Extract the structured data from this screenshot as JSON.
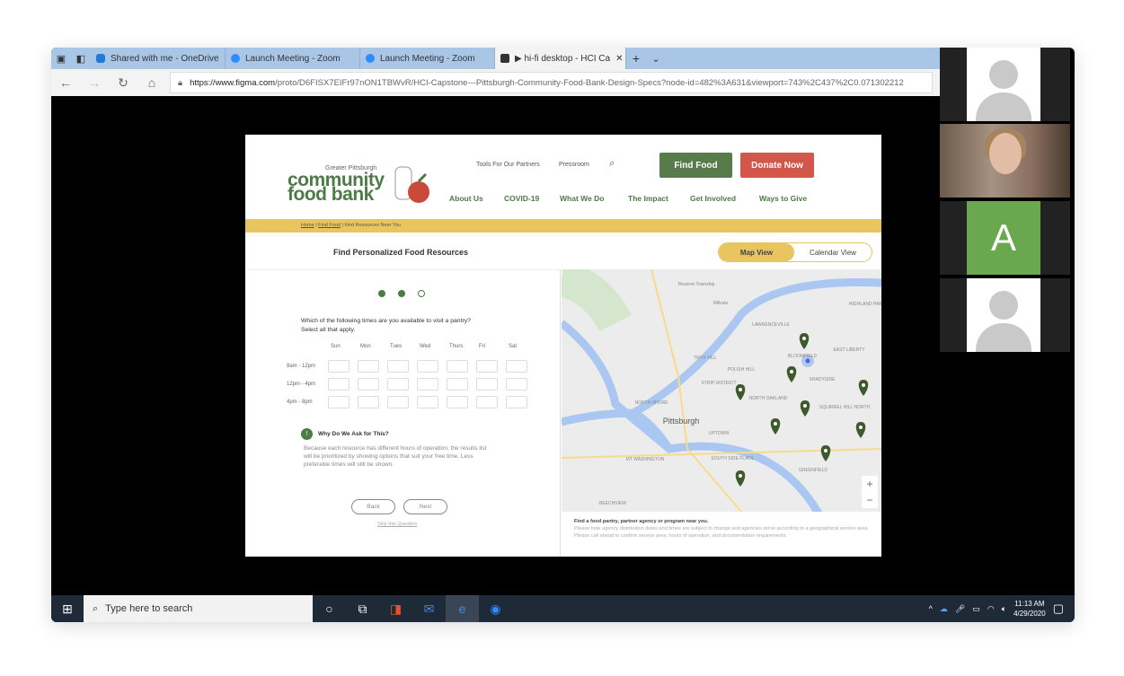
{
  "browser": {
    "tabs": [
      {
        "label": "Shared with me - OneDrive",
        "icon": "cloud-icon"
      },
      {
        "label": "Launch Meeting - Zoom",
        "icon": "zoom-icon"
      },
      {
        "label": "Launch Meeting - Zoom",
        "icon": "zoom-icon"
      },
      {
        "label": "▶ hi-fi desktop - HCI Ca",
        "icon": "figma-icon",
        "active": true
      }
    ],
    "close": "✕",
    "new_tab": "+",
    "tab_menu": "⌄",
    "url_domain": "https://www.figma.com",
    "url_path": "/proto/D6FISX7EIFr97nON1TBWvR/HCI-Capstone---Pittsburgh-Community-Food-Bank-Design-Specs?node-id=482%3A631&viewport=743%2C437%2C0.071302212"
  },
  "participants": [
    {
      "type": "placeholder"
    },
    {
      "type": "video"
    },
    {
      "type": "avatar",
      "initial": "A",
      "color": "#6aa84f"
    },
    {
      "type": "placeholder"
    }
  ],
  "site": {
    "logo": {
      "top": "Greater Pittsburgh",
      "line1": "community",
      "line2": "food bank"
    },
    "top_links": [
      "Tools For Our Partners",
      "Pressroom"
    ],
    "find_food": "Find Food",
    "donate": "Donate Now",
    "colors": {
      "green": "#4d7a47",
      "red": "#d2574a",
      "yellow": "#e8c55e"
    },
    "menu": [
      "About Us",
      "COVID-19",
      "What We Do",
      "The Impact",
      "Get Involved",
      "Ways to Give"
    ],
    "breadcrumb": {
      "home": "Home",
      "find": "Find Food",
      "current": "Find Resources Near You"
    },
    "title": "Find Personalized Food Resources",
    "views": {
      "map": "Map View",
      "calendar": "Calendar View",
      "selected": "Map View"
    },
    "progress": {
      "current_step": 2,
      "total_steps": 3
    },
    "question": "Which of the following times are you available to visit a pantry?",
    "question_hint": "Select all that apply.",
    "days": [
      "Sun",
      "Mon",
      "Tues",
      "Wed",
      "Thurs",
      "Fri",
      "Sat"
    ],
    "times": [
      "8am - 12pm",
      "12pm - 4pm",
      "4pm - 8pm"
    ],
    "why": {
      "icon": "!",
      "title": "Why Do We Ask for This?",
      "text": "Because each resource has different hours of operation, the results list will be prioritized by showing options that suit your free time. Less preferable times will still be shown."
    },
    "back": "Back",
    "next": "Next",
    "skip": "Skip this Question",
    "map": {
      "labels": [
        "Reserve Township",
        "Millvale",
        "LAWRENCEVILLE",
        "HIGHLAND PARK",
        "TROY HILL",
        "POLISH HILL",
        "STRIP DISTRICT",
        "BLOOMFIELD",
        "EAST LIBERTY",
        "SHADYSIDE",
        "NORTH OAKLAND",
        "SQUIRREL HILL NORTH",
        "NORTH SHORE",
        "Pittsburgh",
        "UPTOWN",
        "MT WASHINGTON",
        "SOUTH SIDE FLATS",
        "GREENFIELD",
        "BEECHVIEW"
      ],
      "zoom_in": "+",
      "zoom_out": "−"
    },
    "map_info": {
      "title": "Find a food pantry, partner agency or program near you.",
      "text": "Please note agency distribution dates and times are subject to change and agencies serve according to a geographical service area. Please call ahead to confirm service area, hours of operation, and documentation requirements."
    }
  },
  "taskbar": {
    "search_placeholder": "Type here to search",
    "time": "11:13 AM",
    "date": "4/29/2020"
  }
}
